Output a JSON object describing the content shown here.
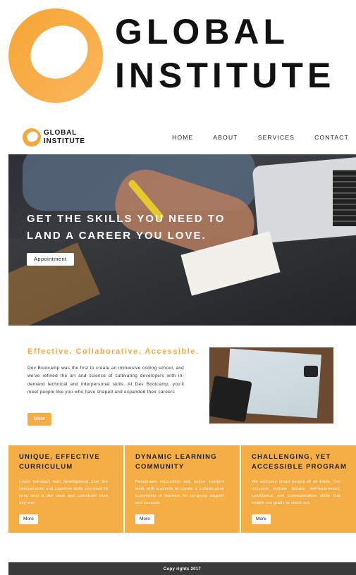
{
  "brand": {
    "line1": "GLOBAL",
    "line2": "INSTITUTE",
    "accent_color": "#f5a93a"
  },
  "nav": {
    "items": [
      {
        "label": "HOME"
      },
      {
        "label": "ABOUT"
      },
      {
        "label": "SERVICES"
      },
      {
        "label": "CONTACT"
      }
    ]
  },
  "hero": {
    "title_line1": "GET THE SKILLS YOU NEED TO",
    "title_line2": "LAND A CAREER YOU LOVE.",
    "button": "Appointment"
  },
  "intro": {
    "heading": "Effective. Collaborative. Accessible.",
    "text": "Dev Bootcamp was the first to create an immersive coding school, and we've refined the art and science of cultivating developers with in-demand technical and interpersonal skills. At Dev Bootcamp, you'll meet people like you who have shaped and expanded their careers",
    "button": "More"
  },
  "features": [
    {
      "heading": "UNIQUE, EFFECTIVE CURRICULUM",
      "text": "Learn full-stack web development plus the interpersonal and cognitive skills you need to jump onto a dev team and contribute from day one.",
      "button": "More"
    },
    {
      "heading": "DYNAMIC LEARNING COMMUNITY",
      "text": "Passionate instructors and active mentors work with students to create a collaborative community of learners for on-going support and success.",
      "button": "More"
    },
    {
      "heading": "CHALLENGING, YET ACCESSIBLE PROGRAM",
      "text": "We welcome smart people of all kinds. Our inclusive culture fosters self-awareness, confidence, and communication skills that enable our grads to stand out.",
      "button": "More"
    }
  ],
  "footer": {
    "text": "Copy rights 2017"
  }
}
